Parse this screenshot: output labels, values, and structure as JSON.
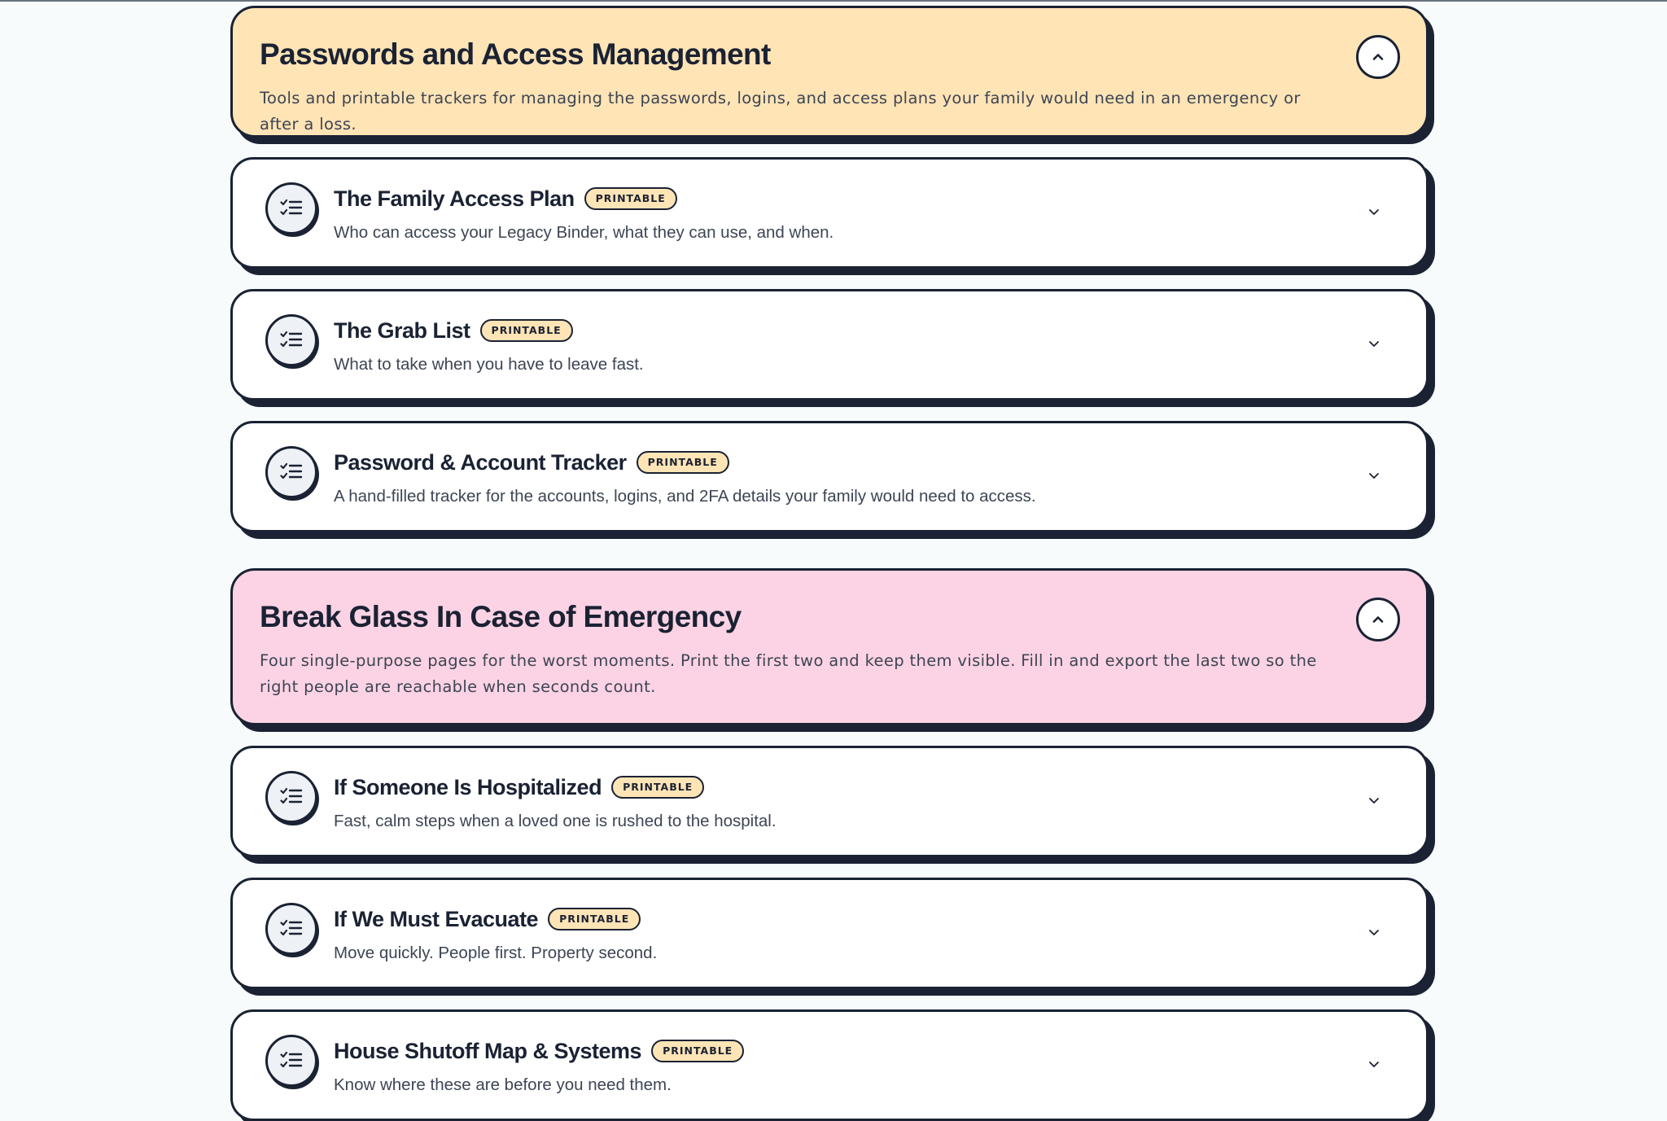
{
  "sections": [
    {
      "title": "Passwords and Access Management",
      "description": "Tools and printable trackers for managing the passwords, logins, and access plans your family would need in an emergency or after a loss.",
      "color": "#ffe4b6",
      "toggle_icon": "chevron-up-icon",
      "items": [
        {
          "title": "The Family Access Plan",
          "badge": "PRINTABLE",
          "description": "Who can access your Legacy Binder, what they can use, and when.",
          "icon": "checklist-icon"
        },
        {
          "title": "The Grab List",
          "badge": "PRINTABLE",
          "description": "What to take when you have to leave fast.",
          "icon": "checklist-icon"
        },
        {
          "title": "Password & Account Tracker",
          "badge": "PRINTABLE",
          "description": "A hand-filled tracker for the accounts, logins, and 2FA details your family would need to access.",
          "icon": "checklist-icon"
        }
      ]
    },
    {
      "title": "Break Glass In Case of Emergency",
      "description": "Four single-purpose pages for the worst moments. Print the first two and keep them visible. Fill in and export the last two so the right people are reachable when seconds count.",
      "color": "#fcd3e4",
      "toggle_icon": "chevron-up-icon",
      "items": [
        {
          "title": "If Someone Is Hospitalized",
          "badge": "PRINTABLE",
          "description": "Fast, calm steps when a loved one is rushed to the hospital.",
          "icon": "checklist-icon"
        },
        {
          "title": "If We Must Evacuate",
          "badge": "PRINTABLE",
          "description": "Move quickly. People first. Property second.",
          "icon": "checklist-icon"
        },
        {
          "title": "House Shutoff Map & Systems",
          "badge": "PRINTABLE",
          "description": "Know where these are before you need them.",
          "icon": "checklist-icon"
        }
      ]
    }
  ]
}
